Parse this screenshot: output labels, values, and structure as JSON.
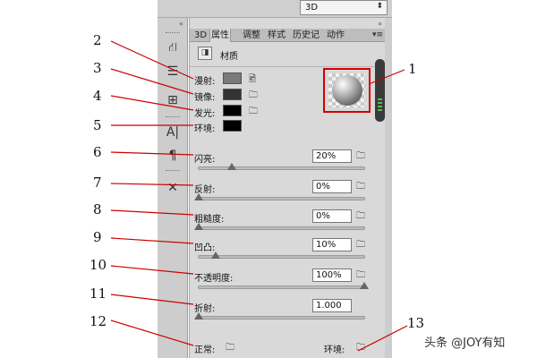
{
  "top_select": {
    "value": "3D"
  },
  "tabs": [
    {
      "label": "3D"
    },
    {
      "label": "属性"
    },
    {
      "label": "调整"
    },
    {
      "label": "样式"
    },
    {
      "label": "历史记"
    },
    {
      "label": "动作"
    }
  ],
  "panel": {
    "title": "材质"
  },
  "color_props": [
    {
      "label": "漫射:",
      "color": "#7a7a7a"
    },
    {
      "label": "镜像:",
      "color": "#333333"
    },
    {
      "label": "发光:",
      "color": "#000000"
    },
    {
      "label": "环境:",
      "color": "#000000"
    }
  ],
  "sliders": [
    {
      "label": "闪亮:",
      "value": "20%",
      "fraction": 0.2
    },
    {
      "label": "反射:",
      "value": "0%",
      "fraction": 0.0
    },
    {
      "label": "粗糙度:",
      "value": "0%",
      "fraction": 0.0
    },
    {
      "label": "凹凸:",
      "value": "10%",
      "fraction": 0.1
    },
    {
      "label": "不透明度:",
      "value": "100%",
      "fraction": 1.0
    },
    {
      "label": "折射:",
      "value": "1.000",
      "fraction": 0.0
    }
  ],
  "bottom": {
    "left_label": "正常:",
    "right_label": "环境:"
  },
  "callouts": [
    "1",
    "2",
    "3",
    "4",
    "5",
    "6",
    "7",
    "8",
    "9",
    "10",
    "11",
    "12",
    "13"
  ],
  "watermark": "头条 @JOY有知",
  "colors": {
    "callout_line": "#cc0000",
    "highlight": "#d40000"
  }
}
